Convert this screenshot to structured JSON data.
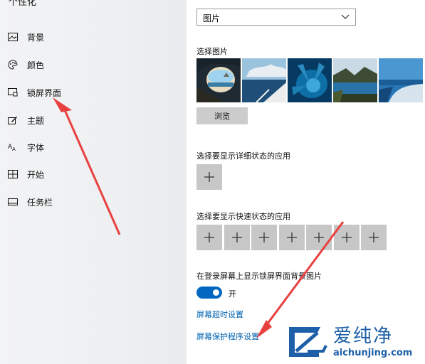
{
  "sidebar": {
    "header": "个性化",
    "items": [
      {
        "label": "背景",
        "icon": "picture-icon"
      },
      {
        "label": "颜色",
        "icon": "palette-icon"
      },
      {
        "label": "锁屏界面",
        "icon": "lock-screen-icon"
      },
      {
        "label": "主题",
        "icon": "theme-icon"
      },
      {
        "label": "字体",
        "icon": "font-icon"
      },
      {
        "label": "开始",
        "icon": "start-icon"
      },
      {
        "label": "任务栏",
        "icon": "taskbar-icon"
      }
    ],
    "selected_index": 2
  },
  "main": {
    "background_dropdown": {
      "value": "图片"
    },
    "choose_picture_label": "选择图片",
    "browse_label": "浏览",
    "detailed_status_label": "选择要显示详细状态的应用",
    "quick_status_label": "选择要显示快速状态的应用",
    "plus_symbol": "+",
    "signin_bg_label": "在登录屏幕上显示锁屏界面背景图片",
    "toggle_state_text": "开",
    "screen_timeout_link": "屏幕超时设置",
    "screensaver_link": "屏幕保护程序设置"
  },
  "watermark": {
    "brand_cn": "爱纯净",
    "url": "aichunjing.com"
  },
  "colors": {
    "accent": "#0067c0",
    "link": "#0063b1",
    "arrow": "#e8413f"
  }
}
